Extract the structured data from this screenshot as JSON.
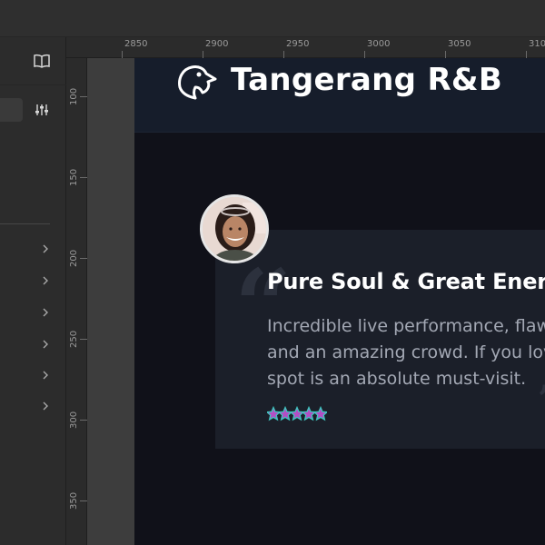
{
  "ruler": {
    "top_ticks": [
      "2850",
      "2900",
      "2950",
      "3000",
      "3050",
      "310"
    ],
    "left_ticks": [
      "100",
      "150",
      "200",
      "250",
      "300",
      "350"
    ]
  },
  "site": {
    "brand": "Tangerang R&B",
    "logo_icon": "eagle-head-icon"
  },
  "review": {
    "headline": "Pure Soul & Great Energy!",
    "body_lines": [
      "Incredible live performance, flawless",
      "and an amazing crowd. If you love liv",
      "spot is an absolute must-visit."
    ],
    "rating": 5,
    "rating_max": 5
  },
  "colors": {
    "accent_star_fill": "#b44dc4",
    "accent_star_outline": "#3fc6c0",
    "site_bg": "#101119",
    "header_bg": "#161d2b"
  }
}
